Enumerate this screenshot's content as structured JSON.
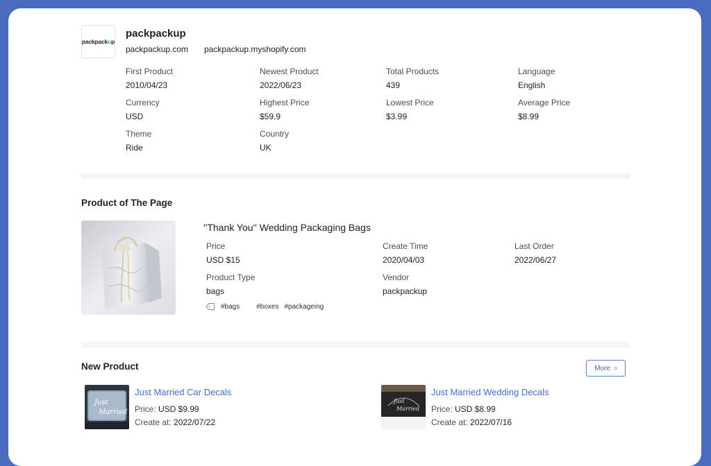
{
  "store": {
    "logo_text_pre": "packpack",
    "logo_text_u": "u",
    "logo_text_post": "p",
    "name": "packpackup",
    "domain": "packpackup.com",
    "shopify_domain": "packpackup.myshopify.com"
  },
  "stats": [
    {
      "label": "First Product",
      "value": "2010/04/23"
    },
    {
      "label": "Newest Product",
      "value": "2022/06/23"
    },
    {
      "label": "Total Products",
      "value": "439"
    },
    {
      "label": "Language",
      "value": "English"
    },
    {
      "label": "Currency",
      "value": "USD"
    },
    {
      "label": "Highest Price",
      "value": "$59.9"
    },
    {
      "label": "Lowest Price",
      "value": "$3.99"
    },
    {
      "label": "Average Price",
      "value": "$8.99"
    },
    {
      "label": "Theme",
      "value": "Ride"
    },
    {
      "label": "Country",
      "value": "UK"
    }
  ],
  "product_of_page": {
    "section_title": "Product of The Page",
    "name": "''Thank You'' Wedding Packaging Bags",
    "fields": [
      {
        "label": "Price",
        "value": "USD $15"
      },
      {
        "label": "Create Time",
        "value": "2020/04/03"
      },
      {
        "label": "Last Order",
        "value": "2022/06/27"
      },
      {
        "label": "Product Type",
        "value": "bags"
      },
      {
        "label": "Vendor",
        "value": "packpackup"
      }
    ],
    "tags": [
      "#bags",
      "#boxes",
      "#packageing"
    ]
  },
  "new_product": {
    "section_title": "New Product",
    "more_label": "More",
    "price_label": "Price: ",
    "create_label": "Create at: ",
    "items": [
      {
        "title": "Just Married Car Decals",
        "price": "USD $9.99",
        "created": "2022/07/22",
        "thumb_text_1": "Just",
        "thumb_text_2": "Married"
      },
      {
        "title": "Just Married Wedding Decals",
        "price": "USD $8.99",
        "created": "2022/07/16",
        "thumb_text_1": "Just",
        "thumb_text_2": "Married"
      }
    ]
  }
}
